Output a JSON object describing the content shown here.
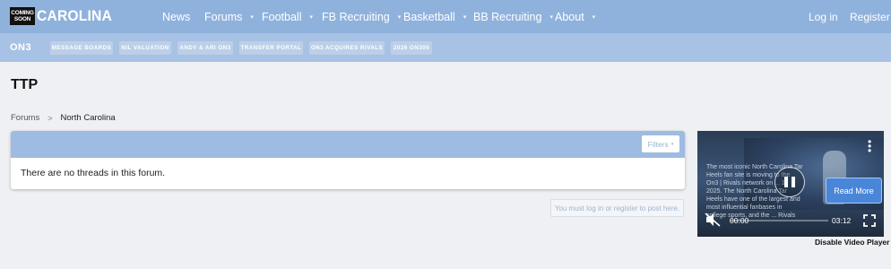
{
  "brand": {
    "badge_line1": "COMING",
    "badge_line2": "SOON",
    "name": "CAROLINA"
  },
  "nav": {
    "items": [
      {
        "label": "News",
        "has_caret": false
      },
      {
        "label": "Forums",
        "has_caret": true
      },
      {
        "label": "Football",
        "has_caret": true
      },
      {
        "label": "FB Recruiting",
        "has_caret": true
      },
      {
        "label": "Basketball",
        "has_caret": true
      },
      {
        "label": "BB Recruiting",
        "has_caret": true
      },
      {
        "label": "About",
        "has_caret": true
      }
    ],
    "caret": "▾",
    "login": "Log in",
    "register": "Register"
  },
  "subnav": {
    "logo": "ON3",
    "chips": [
      "MESSAGE BOARDS",
      "NIL VALUATION",
      "ANDY & ARI ON3",
      "TRANSFER PORTAL",
      "ON3 ACQUIRES RIVALS",
      "2026 ON300"
    ]
  },
  "page": {
    "title": "TTP",
    "breadcrumb": {
      "parent": "Forums",
      "separator": ">",
      "current": "North Carolina"
    },
    "filters_label": "Filters",
    "empty_message": "There are no threads in this forum.",
    "post_note": "You must log in or register to post here."
  },
  "video": {
    "description": "The most iconic North Carolina Tar Heels fan site is moving to the On3 | Rivals network on ... 1, 2025. The North Carolina Tar Heels have one of the largest and most influential fanbases in college sports, and the ... Rivals is...",
    "read_more": "Read More",
    "time_current": "00:00",
    "time_duration": "03:12",
    "progress": 0,
    "disable_label": "Disable Video Player"
  },
  "colors": {
    "nav_bg": "#8fb2dc",
    "subnav_bg": "#a8c2e5",
    "block_header": "#9ebbe1",
    "read_more_bg": "#4a86d8",
    "page_bg": "#eef0f3"
  },
  "icons": {
    "caret": "chevron-down-icon",
    "pause": "pause-icon",
    "mute": "mute-icon",
    "fullscreen": "fullscreen-icon",
    "menu": "kebab-menu-icon"
  }
}
